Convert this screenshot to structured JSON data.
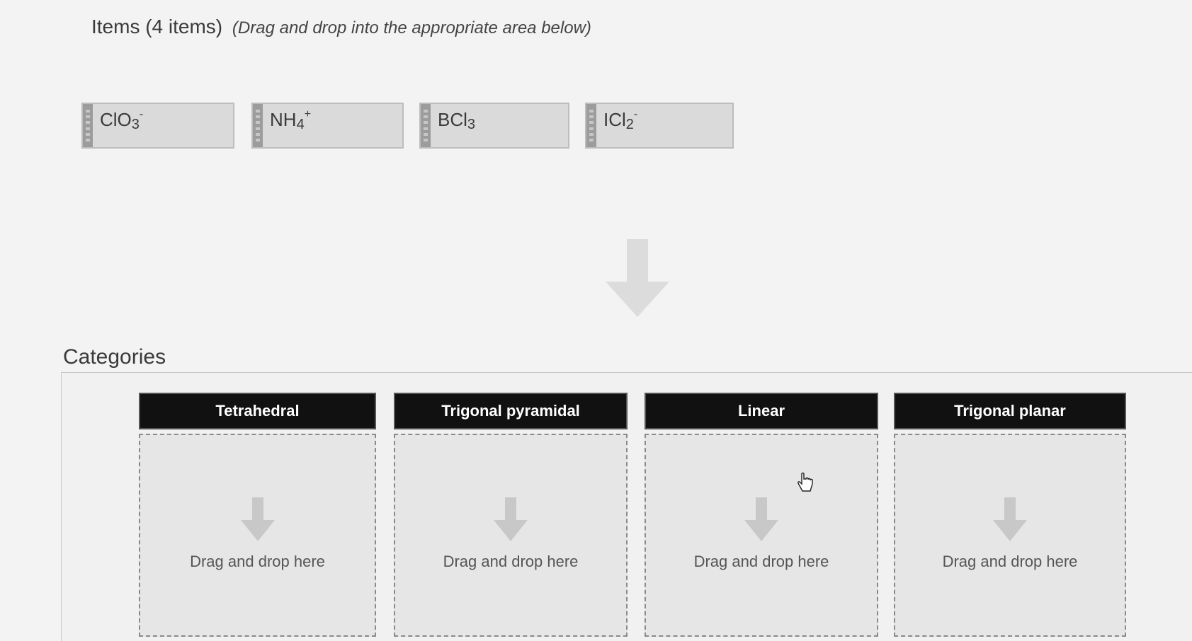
{
  "items_section": {
    "title": "Items (4 items)",
    "hint": "(Drag and drop into the appropriate area below)"
  },
  "items": [
    {
      "base": "ClO",
      "sub": "3",
      "sup": "-"
    },
    {
      "base": "NH",
      "sub": "4",
      "sup": "+"
    },
    {
      "base": "BCl",
      "sub": "3",
      "sup": ""
    },
    {
      "base": "ICl",
      "sub": "2",
      "sup": "-"
    }
  ],
  "categories_section": {
    "title": "Categories"
  },
  "categories": [
    {
      "name": "Tetrahedral",
      "drop_text": "Drag and drop here"
    },
    {
      "name": "Trigonal pyramidal",
      "drop_text": "Drag and drop here"
    },
    {
      "name": "Linear",
      "drop_text": "Drag and drop here"
    },
    {
      "name": "Trigonal planar",
      "drop_text": "Drag and drop here"
    }
  ],
  "colors": {
    "header_bg": "#111111",
    "tile_bg": "#dadada",
    "arrow": "#dcdcdc"
  },
  "icons": {
    "down_arrow": "down-arrow-icon",
    "cursor": "hand-pointer-icon",
    "grip": "drag-handle-icon"
  }
}
